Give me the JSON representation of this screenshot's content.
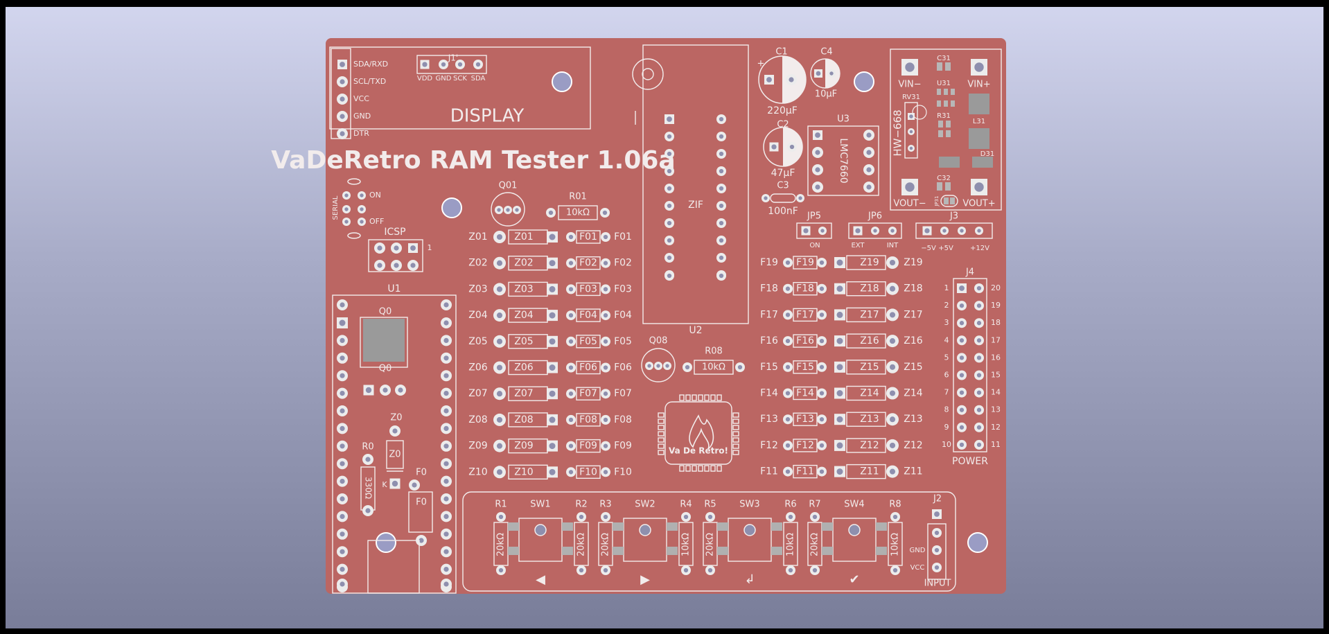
{
  "board": {
    "title": "VaDeRetro RAM Tester 1.06a",
    "colors": {
      "pcb": "#bb6663",
      "silk": "#f2ecec",
      "pad": "#ececec",
      "hole": "#9a9cc4",
      "background_top": "#d2d5ee",
      "background_bottom": "#797d99"
    },
    "display": {
      "ref": "J1",
      "ref2": "J1'",
      "label": "DISPLAY",
      "pins": [
        "SDA/RXD",
        "SCL/TXD",
        "VCC",
        "GND",
        "DTR"
      ],
      "header_pins": [
        "VDD",
        "GND",
        "SCK",
        "SDA"
      ]
    },
    "serial": {
      "label": "SERIAL",
      "on": "ON",
      "off": "OFF"
    },
    "icsp": {
      "ref": "ICSP",
      "pin1": "1"
    },
    "u1": {
      "ref": "U1",
      "q0": "Q0",
      "q0b": "Q0",
      "z0": "Z0",
      "z0b": "Z0",
      "k": "K",
      "r0": "R0",
      "r0_value": "330Ω",
      "f0": "F0",
      "f0b": "F0"
    },
    "q01": {
      "ref": "Q01"
    },
    "r01": {
      "ref": "R01",
      "value": "10kΩ"
    },
    "q08": {
      "ref": "Q08"
    },
    "r08": {
      "ref": "R08",
      "value": "10kΩ"
    },
    "zif": {
      "label": "ZIF",
      "ref": "U2"
    },
    "logo": {
      "text": "Va De Retro!"
    },
    "left_rows": [
      "01",
      "02",
      "03",
      "04",
      "05",
      "06",
      "07",
      "08",
      "09",
      "10"
    ],
    "right_rows": [
      "19",
      "18",
      "17",
      "16",
      "15",
      "14",
      "13",
      "12",
      "11"
    ],
    "caps": {
      "c1": "C1",
      "c1_value": "220µF",
      "c4": "C4",
      "c4_value": "10µF",
      "c2": "C2",
      "c2_value": "47µF",
      "c3": "C3",
      "c3_value": "100nF"
    },
    "u3": {
      "ref": "U3",
      "part": "LMC7660"
    },
    "converter": {
      "vin_minus": "VIN−",
      "vin_plus": "VIN+",
      "vout_minus": "VOUT−",
      "vout_plus": "VOUT+",
      "module": "HW−668",
      "rv31": "RV31",
      "c31": "C31",
      "u31": "U31",
      "r31": "R31",
      "l31": "L31",
      "d31": "D31",
      "c32": "C32",
      "jp31": "JP31"
    },
    "jp5": {
      "ref": "JP5",
      "on": "ON"
    },
    "jp6": {
      "ref": "JP6",
      "ext": "EXT",
      "int": "INT"
    },
    "j3": {
      "ref": "J3",
      "pins": [
        "−5V",
        "+5V",
        "+12V"
      ]
    },
    "j4": {
      "ref": "J4",
      "label": "POWER",
      "left": [
        "1",
        "2",
        "3",
        "4",
        "5",
        "6",
        "7",
        "8",
        "9",
        "10"
      ],
      "right": [
        "20",
        "19",
        "18",
        "17",
        "16",
        "15",
        "14",
        "13",
        "12",
        "11"
      ]
    },
    "buttons": [
      {
        "sw": "SW1",
        "r_left": "R1",
        "r_left_val": "20kΩ",
        "r_right": "R2",
        "r_right_val": "20kΩ",
        "symbol": "◀"
      },
      {
        "sw": "SW2",
        "r_left": "R3",
        "r_left_val": "20kΩ",
        "r_right": "R4",
        "r_right_val": "10kΩ",
        "symbol": "▶"
      },
      {
        "sw": "SW3",
        "r_left": "R5",
        "r_left_val": "20kΩ",
        "r_right": "R6",
        "r_right_val": "10kΩ",
        "symbol": "↲"
      },
      {
        "sw": "SW4",
        "r_left": "R7",
        "r_left_val": "20kΩ",
        "r_right": "R8",
        "r_right_val": "10kΩ",
        "symbol": "✔"
      }
    ],
    "j2": {
      "ref": "J2",
      "gnd": "GND",
      "vcc": "VCC",
      "label": "INPUT"
    }
  }
}
